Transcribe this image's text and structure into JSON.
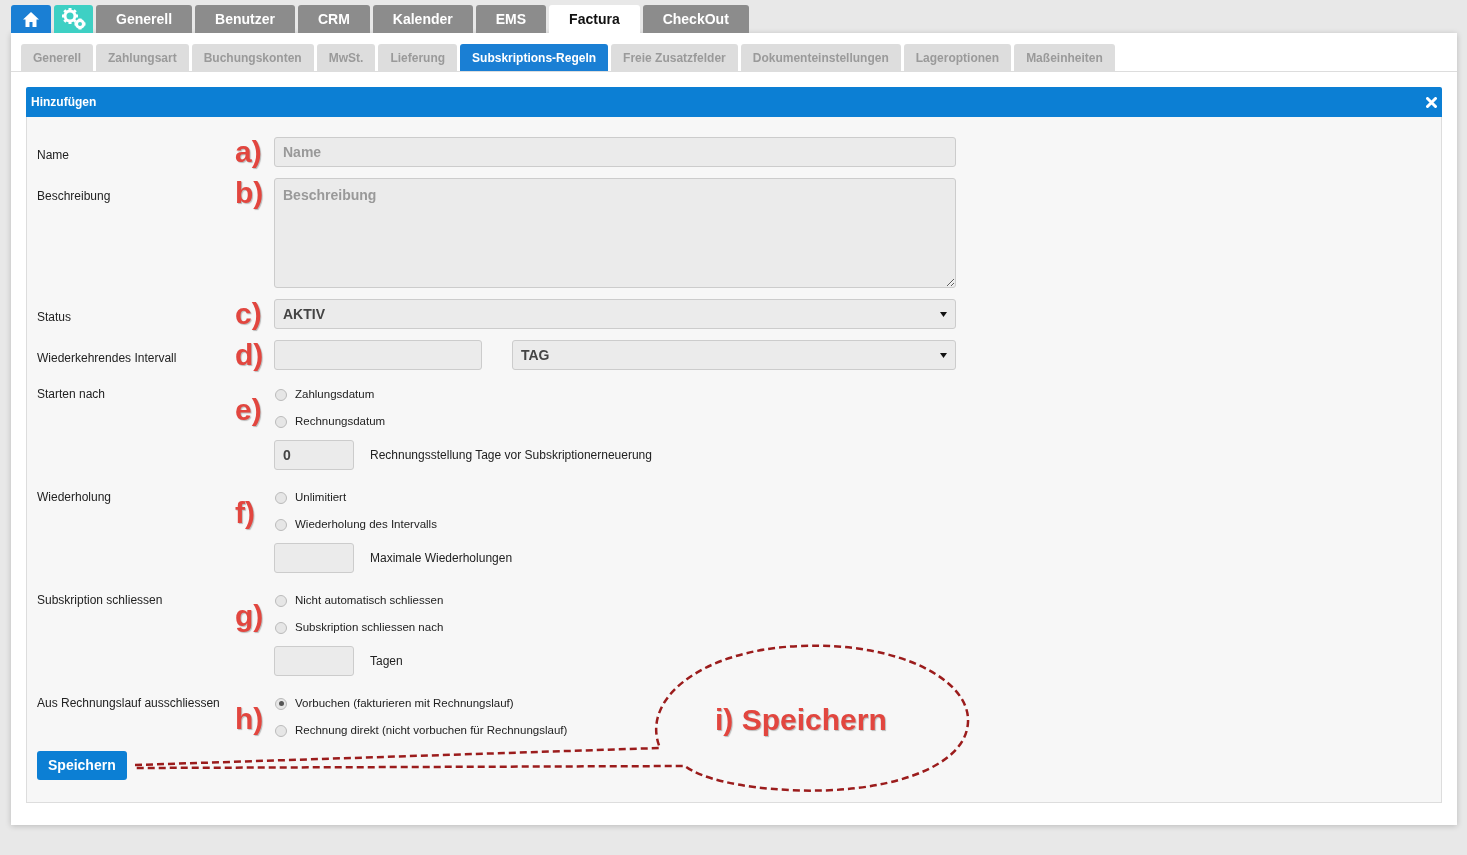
{
  "main_tabs": [
    {
      "kind": "home"
    },
    {
      "kind": "settings"
    },
    {
      "kind": "text",
      "label": "Generell",
      "selected": false
    },
    {
      "kind": "text",
      "label": "Benutzer",
      "selected": false
    },
    {
      "kind": "text",
      "label": "CRM",
      "selected": false
    },
    {
      "kind": "text",
      "label": "Kalender",
      "selected": false
    },
    {
      "kind": "text",
      "label": "EMS",
      "selected": false
    },
    {
      "kind": "text",
      "label": "Factura",
      "selected": true
    },
    {
      "kind": "text",
      "label": "CheckOut",
      "selected": false
    }
  ],
  "sub_tabs": [
    {
      "label": "Generell",
      "selected": false
    },
    {
      "label": "Zahlungsart",
      "selected": false
    },
    {
      "label": "Buchungskonten",
      "selected": false
    },
    {
      "label": "MwSt.",
      "selected": false
    },
    {
      "label": "Lieferung",
      "selected": false
    },
    {
      "label": "Subskriptions-Regeln",
      "selected": true
    },
    {
      "label": "Freie Zusatzfelder",
      "selected": false
    },
    {
      "label": "Dokumenteinstellungen",
      "selected": false
    },
    {
      "label": "Lageroptionen",
      "selected": false
    },
    {
      "label": "Maßeinheiten",
      "selected": false
    }
  ],
  "panel": {
    "title": "Hinzufügen"
  },
  "form": {
    "rows": [
      {
        "kind": "text",
        "label": "Name",
        "marker": "a)",
        "placeholder": "Name"
      },
      {
        "kind": "textarea",
        "label": "Beschreibung",
        "marker": "b)",
        "placeholder": "Beschreibung"
      },
      {
        "kind": "select",
        "label": "Status",
        "marker": "c)",
        "value": "AKTIV"
      },
      {
        "kind": "interval",
        "label": "Wiederkehrendes Intervall",
        "marker": "d)",
        "unit": "TAG"
      },
      {
        "kind": "radios",
        "label": "Starten nach",
        "marker": "e)",
        "options": [
          {
            "label": "Zahlungsdatum",
            "selected": false
          },
          {
            "label": "Rechnungsdatum",
            "selected": false
          }
        ],
        "extra": {
          "value": "0",
          "caption": "Rechnungsstellung Tage vor Subskriptionerneuerung"
        }
      },
      {
        "kind": "radios",
        "label": "Wiederholung",
        "marker": "f)",
        "options": [
          {
            "label": "Unlimitiert",
            "selected": false
          },
          {
            "label": "Wiederholung des Intervalls",
            "selected": false
          }
        ],
        "extra": {
          "caption": "Maximale Wiederholungen"
        }
      },
      {
        "kind": "radios",
        "label": "Subskription schliessen",
        "marker": "g)",
        "options": [
          {
            "label": "Nicht automatisch schliessen",
            "selected": false
          },
          {
            "label": "Subskription schliessen nach",
            "selected": false
          }
        ],
        "extra": {
          "caption": "Tagen"
        }
      },
      {
        "kind": "radios",
        "label": "Aus Rechnungslauf ausschliessen",
        "marker": "h)",
        "options": [
          {
            "label": "Vorbuchen (fakturieren mit Rechnungslauf)",
            "selected": true
          },
          {
            "label": "Rechnung direkt (nicht vorbuchen für Rechnungslauf)",
            "selected": false
          }
        ]
      }
    ]
  },
  "save_button": "Speichern",
  "callout": "i) Speichern"
}
